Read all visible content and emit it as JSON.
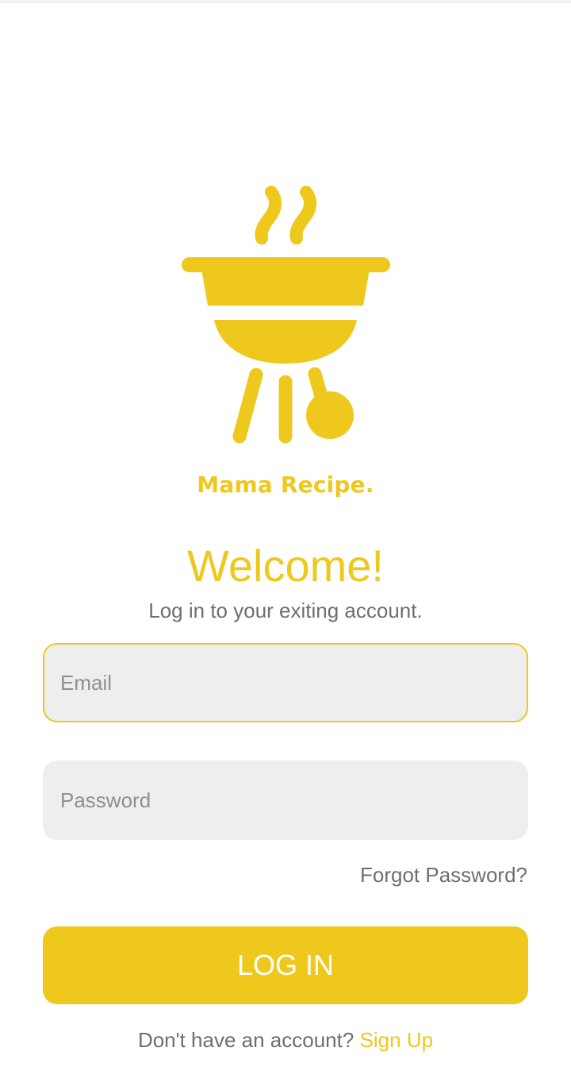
{
  "brand": {
    "name": "Mama Recipe.",
    "logo_icon": "grill-icon",
    "accent_color": "#eec81c"
  },
  "welcome": {
    "title": "Welcome!",
    "subtitle": "Log in to your exiting account."
  },
  "form": {
    "email": {
      "placeholder": "Email",
      "value": ""
    },
    "password": {
      "placeholder": "Password",
      "value": ""
    },
    "forgot_label": "Forgot Password?",
    "login_label": "LOG IN"
  },
  "footer": {
    "prompt": "Don't have an account?",
    "signup_label": "Sign Up"
  }
}
